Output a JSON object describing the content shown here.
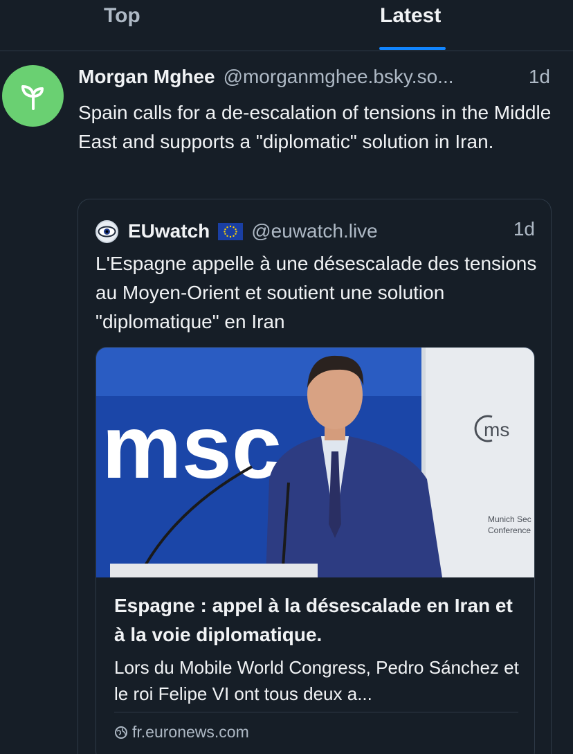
{
  "tabs": [
    {
      "label": "Top",
      "active": false
    },
    {
      "label": "Latest",
      "active": true
    }
  ],
  "colors": {
    "background": "#161e27",
    "accent": "#1185fe",
    "avatar": "#6ad072",
    "muted": "#aeb9c5"
  },
  "post": {
    "avatar_icon": "sprout-icon",
    "author": "Morgan Mghee",
    "handle": "@morganmghee.bsky.so...",
    "time": "1d",
    "text": "Spain calls for a de-escalation of tensions in the Middle East and supports a \"diplomatic\" solution in Iran."
  },
  "quote": {
    "avatar_icon": "eye-logo-icon",
    "author": "EUwatch",
    "flag_icon": "eu-flag-icon",
    "handle": "@euwatch.live",
    "time": "1d",
    "text": "L'Espagne appelle à une désescalade des tensions au Moyen-Orient et soutient une solution \"diplomatique\" en Iran",
    "card": {
      "image_text": "msc",
      "image_logo_text": "ms",
      "image_small_text_1": "Munich Sec",
      "image_small_text_2": "Conference",
      "title": "Espagne : appel à la désescalade en Iran et à la voie diplomatique.",
      "description": "Lors du Mobile World Congress, Pedro Sánchez et le roi Felipe VI ont tous deux a...",
      "domain_icon": "globe-icon",
      "domain": "fr.euronews.com"
    }
  }
}
